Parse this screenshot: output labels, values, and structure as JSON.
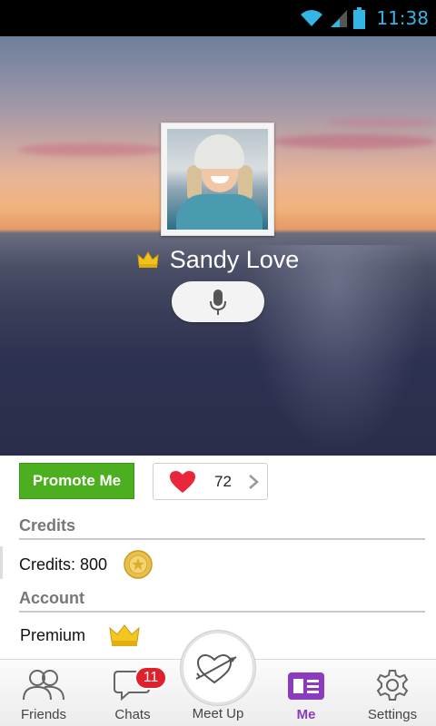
{
  "status_bar": {
    "time": "11:38"
  },
  "profile": {
    "name": "Sandy Love"
  },
  "actions": {
    "promote_label": "Promote Me",
    "likes_count": "72"
  },
  "credits": {
    "header": "Credits",
    "label": "Credits: 800"
  },
  "account": {
    "header": "Account",
    "premium_label": "Premium"
  },
  "tabs": [
    {
      "label": "Friends"
    },
    {
      "label": "Chats",
      "badge": "11"
    },
    {
      "label": "Meet Up"
    },
    {
      "label": "Me"
    },
    {
      "label": "Settings"
    }
  ],
  "colors": {
    "accent": "#8a3bbf",
    "promote": "#4caf1f",
    "badge": "#e0202a",
    "status_time": "#33b5e5"
  },
  "icons": [
    "wifi-icon",
    "signal-icon",
    "battery-icon",
    "crown-icon",
    "microphone-icon",
    "heart-icon",
    "chevron-right-icon",
    "coin-icon",
    "friends-icon",
    "chat-icon",
    "cupid-heart-icon",
    "profile-card-icon",
    "gear-icon"
  ]
}
